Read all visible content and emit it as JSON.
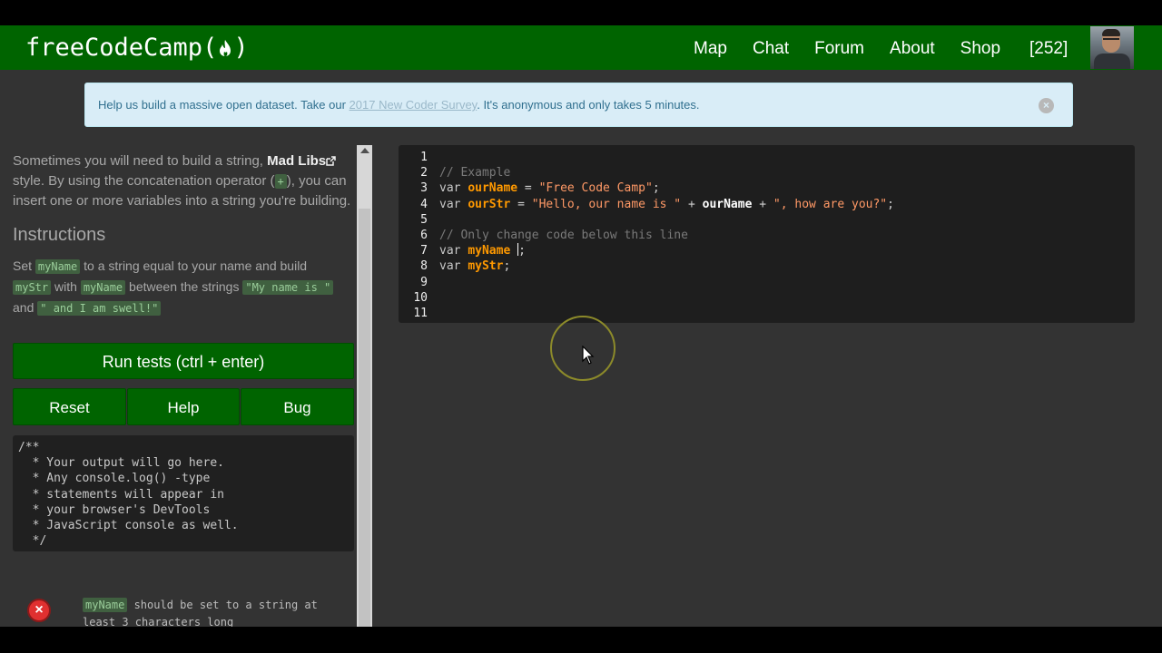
{
  "navbar": {
    "brand": "freeCodeCamp(",
    "brand_close": ")",
    "links": [
      "Map",
      "Chat",
      "Forum",
      "About",
      "Shop"
    ],
    "points": "[252]"
  },
  "alert": {
    "text_before": "Help us build a massive open dataset. Take our ",
    "link": "2017 New Coder Survey",
    "text_after": ". It's anonymous and only takes 5 minutes.",
    "close": "×"
  },
  "lesson": {
    "desc_1": "Sometimes you will need to build a string, ",
    "desc_link": "Mad Libs",
    "desc_2": " style. By using the concatenation operator (",
    "desc_op": "+",
    "desc_3": "), you can insert one or more variables into a string you're building.",
    "instructions_title": "Instructions",
    "instr_1": "Set ",
    "instr_code_1": "myName",
    "instr_2": " to a string equal to your name and build ",
    "instr_code_2": "myStr",
    "instr_3": " with ",
    "instr_code_3": "myName",
    "instr_4": " between the strings ",
    "instr_code_4": "\"My name is \"",
    "instr_5": " and ",
    "instr_code_5": "\" and I am swell!\""
  },
  "buttons": {
    "run": "Run tests (ctrl + enter)",
    "reset": "Reset",
    "help": "Help",
    "bug": "Bug"
  },
  "output": "/**\n  * Your output will go here.\n  * Any console.log() -type\n  * statements will appear in\n  * your browser's DevTools\n  * JavaScript console as well.\n  */",
  "test": {
    "icon": "×",
    "code": "myName",
    "text": " should be set to a string at least 3 characters long"
  },
  "editor": {
    "line_numbers": [
      "1",
      "2",
      "3",
      "4",
      "5",
      "6",
      "7",
      "8",
      "9",
      "10",
      "11"
    ],
    "comment_example": "// Example",
    "kw_var": "var",
    "ourName": "ourName",
    "eq": " = ",
    "str_free": "\"Free Code Camp\"",
    "semi": ";",
    "ourStr": "ourStr",
    "str_hello": "\"Hello, our name is \"",
    "plus": " + ",
    "str_how": "\", how are you?\"",
    "comment_change": "// Only change code below this line",
    "myName": "myName",
    "myStr": "myStr"
  },
  "colors": {
    "navbar": "#006400",
    "background": "#333333",
    "alert_bg": "#d9edf7",
    "button": "#006400",
    "editor_bg": "#1e1e1e",
    "variable": "#ff9900"
  }
}
